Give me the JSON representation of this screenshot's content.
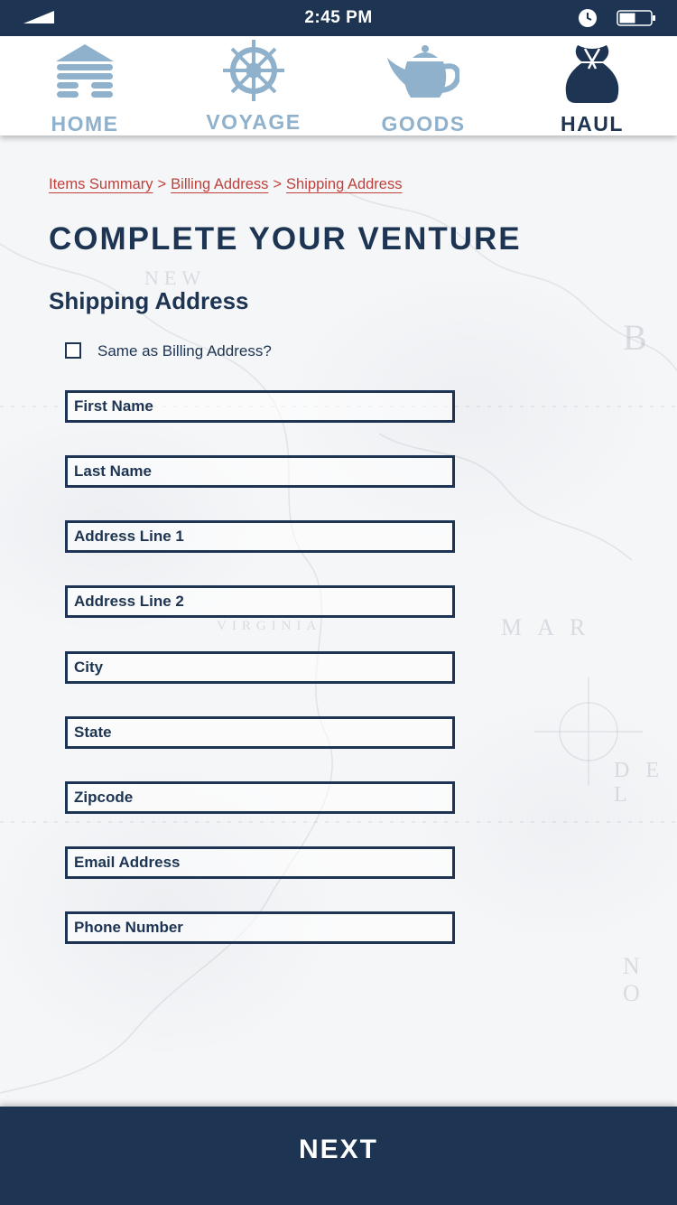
{
  "status_bar": {
    "time": "2:45 PM",
    "icons": [
      "signal-icon",
      "clock-icon",
      "battery-icon"
    ]
  },
  "nav": {
    "items": [
      {
        "label": "HOME",
        "icon": "log-cabin-icon",
        "active": false
      },
      {
        "label": "VOYAGE",
        "icon": "ship-wheel-icon",
        "active": false
      },
      {
        "label": "GOODS",
        "icon": "teapot-icon",
        "active": false
      },
      {
        "label": "HAUL",
        "icon": "sack-icon",
        "active": true
      }
    ]
  },
  "breadcrumb": {
    "items": [
      "Items Summary",
      "Billing Address",
      "Shipping Address"
    ],
    "separator": ">"
  },
  "page_title": "COMPLETE YOUR VENTURE",
  "section_title": "Shipping Address",
  "same_as_billing": {
    "label": "Same as Billing Address?",
    "checked": false
  },
  "form": {
    "fields": [
      {
        "placeholder": "First Name",
        "value": ""
      },
      {
        "placeholder": "Last Name",
        "value": ""
      },
      {
        "placeholder": "Address Line 1",
        "value": ""
      },
      {
        "placeholder": "Address Line 2",
        "value": ""
      },
      {
        "placeholder": "City",
        "value": ""
      },
      {
        "placeholder": "State",
        "value": ""
      },
      {
        "placeholder": "Zipcode",
        "value": ""
      },
      {
        "placeholder": "Email Address",
        "value": ""
      },
      {
        "placeholder": "Phone Number",
        "value": ""
      }
    ]
  },
  "next_button": {
    "label": "NEXT"
  },
  "colors": {
    "navy": "#1d3452",
    "light_blue": "#8fb1cc",
    "link_red": "#c0413b"
  }
}
